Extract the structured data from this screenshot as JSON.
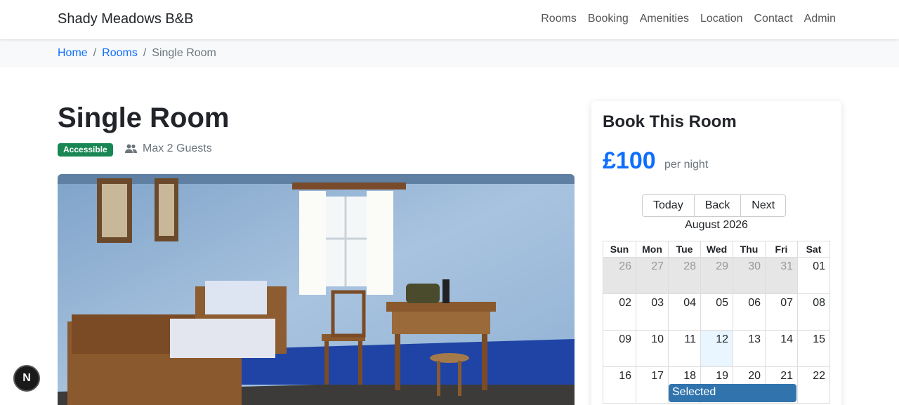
{
  "navbar": {
    "brand": "Shady Meadows B&B",
    "links": [
      "Rooms",
      "Booking",
      "Amenities",
      "Location",
      "Contact",
      "Admin"
    ]
  },
  "breadcrumb": {
    "home": "Home",
    "rooms": "Rooms",
    "current": "Single Room",
    "separator": "/"
  },
  "room": {
    "title": "Single Room",
    "badge": "Accessible",
    "guests": "Max 2 Guests"
  },
  "booking": {
    "title": "Book This Room",
    "price": "£100",
    "per_night": "per night",
    "buttons": [
      "Today",
      "Back",
      "Next"
    ],
    "month": "August 2026",
    "weekdays": [
      "Sun",
      "Mon",
      "Tue",
      "Wed",
      "Thu",
      "Fri",
      "Sat"
    ],
    "weeks": [
      [
        "26",
        "27",
        "28",
        "29",
        "30",
        "31",
        "01"
      ],
      [
        "02",
        "03",
        "04",
        "05",
        "06",
        "07",
        "08"
      ],
      [
        "09",
        "10",
        "11",
        "12",
        "13",
        "14",
        "15"
      ],
      [
        "16",
        "17",
        "18",
        "19",
        "20",
        "21",
        "22"
      ]
    ],
    "event_label": "Selected"
  },
  "fab_label": "N",
  "colors": {
    "accent": "#0d6efd",
    "badge": "#198754",
    "event": "#3174ad"
  }
}
